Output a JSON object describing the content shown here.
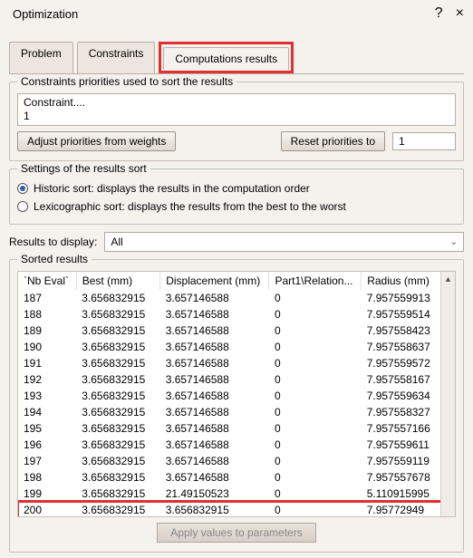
{
  "title": "Optimization",
  "tabs": {
    "problem": "Problem",
    "constraints": "Constraints",
    "results": "Computations results"
  },
  "priorities": {
    "group_label": "Constraints priorities used to sort the results",
    "constraint_header": "Constraint....",
    "constraint_value": "1",
    "btn_adjust": "Adjust priorities from weights",
    "btn_reset": "Reset priorities to",
    "reset_value": "1"
  },
  "sort_settings": {
    "group_label": "Settings of the results sort",
    "historic": "Historic sort: displays the results in the computation order",
    "lexicographic": "Lexicographic sort: displays the results from the best to the worst",
    "selected": "historic"
  },
  "display": {
    "label": "Results to display:",
    "value": "All"
  },
  "results": {
    "group_label": "Sorted results",
    "headers": {
      "nb_eval": "`Nb Eval`",
      "best": "Best (mm)",
      "displacement": "Displacement (mm)",
      "relation": "Part1\\Relation...",
      "radius": "Radius (mm)"
    },
    "rows": [
      {
        "nb": "187",
        "best": "3.656832915",
        "disp": "3.657146588",
        "rel": "0",
        "rad": "7.957559913"
      },
      {
        "nb": "188",
        "best": "3.656832915",
        "disp": "3.657146588",
        "rel": "0",
        "rad": "7.957559514"
      },
      {
        "nb": "189",
        "best": "3.656832915",
        "disp": "3.657146588",
        "rel": "0",
        "rad": "7.957558423"
      },
      {
        "nb": "190",
        "best": "3.656832915",
        "disp": "3.657146588",
        "rel": "0",
        "rad": "7.957558637"
      },
      {
        "nb": "191",
        "best": "3.656832915",
        "disp": "3.657146588",
        "rel": "0",
        "rad": "7.957559572"
      },
      {
        "nb": "192",
        "best": "3.656832915",
        "disp": "3.657146588",
        "rel": "0",
        "rad": "7.957558167"
      },
      {
        "nb": "193",
        "best": "3.656832915",
        "disp": "3.657146588",
        "rel": "0",
        "rad": "7.957559634"
      },
      {
        "nb": "194",
        "best": "3.656832915",
        "disp": "3.657146588",
        "rel": "0",
        "rad": "7.957558327"
      },
      {
        "nb": "195",
        "best": "3.656832915",
        "disp": "3.657146588",
        "rel": "0",
        "rad": "7.957557166"
      },
      {
        "nb": "196",
        "best": "3.656832915",
        "disp": "3.657146588",
        "rel": "0",
        "rad": "7.957559611"
      },
      {
        "nb": "197",
        "best": "3.656832915",
        "disp": "3.657146588",
        "rel": "0",
        "rad": "7.957559119"
      },
      {
        "nb": "198",
        "best": "3.656832915",
        "disp": "3.657146588",
        "rel": "0",
        "rad": "7.957557678"
      },
      {
        "nb": "199",
        "best": "3.656832915",
        "disp": "21.49150523",
        "rel": "0",
        "rad": "5.110915995"
      },
      {
        "nb": "200",
        "best": "3.656832915",
        "disp": "3.656832915",
        "rel": "0",
        "rad": "7.95772949",
        "highlight": true
      }
    ]
  },
  "footer": {
    "apply_btn": "Apply values to parameters"
  }
}
